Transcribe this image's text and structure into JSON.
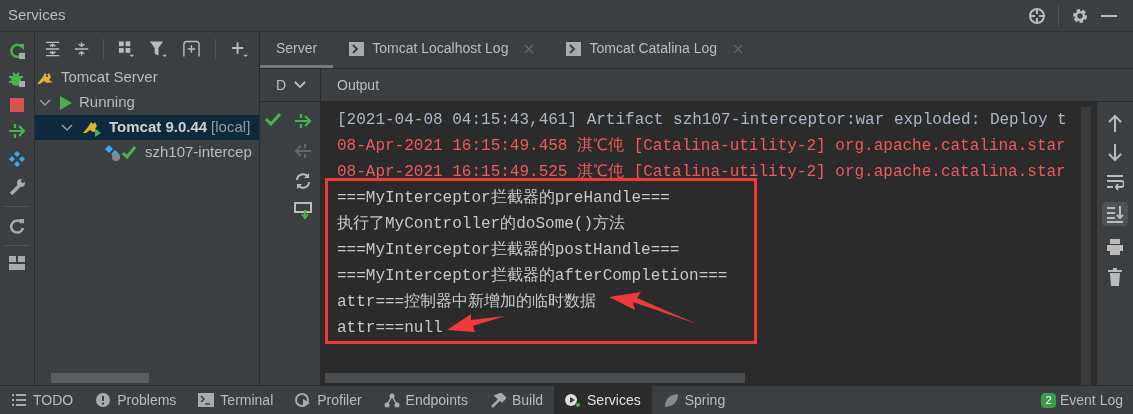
{
  "window": {
    "title": "Services"
  },
  "tree": [
    {
      "label": "Tomcat Server",
      "selected": false,
      "kind": "server",
      "children": [
        {
          "label": "Running",
          "selected": false,
          "expanded": true,
          "kind": "group",
          "children": [
            {
              "label": "Tomcat 9.0.44",
              "suffix": "[local]",
              "selected": true,
              "expanded": true,
              "kind": "instance",
              "children": [
                {
                  "label": "szh107-intercep",
                  "selected": false,
                  "kind": "artifact"
                }
              ]
            }
          ]
        }
      ]
    }
  ],
  "tabs": [
    {
      "label": "Server",
      "selected": true,
      "closable": false
    },
    {
      "label": "Tomcat Localhost Log",
      "selected": false,
      "closable": true
    },
    {
      "label": "Tomcat Catalina Log",
      "selected": false,
      "closable": true
    }
  ],
  "sub_header": {
    "dropdown": "D",
    "title": "Output"
  },
  "console": [
    {
      "text": "[2021-04-08 04:15:43,461] Artifact szh107-interceptor:war exploded: Deploy t",
      "kind": "info"
    },
    {
      "text": "08-Apr-2021 16:15:49.458 淇℃伅 [Catalina-utility-2] org.apache.catalina.star",
      "kind": "error"
    },
    {
      "text": "08-Apr-2021 16:15:49.525 淇℃伅 [Catalina-utility-2] org.apache.catalina.star",
      "kind": "error"
    },
    {
      "text": "===MyInterceptor拦截器的preHandle===",
      "kind": "out"
    },
    {
      "text": "执行了MyController的doSome()方法",
      "kind": "out"
    },
    {
      "text": "===MyInterceptor拦截器的postHandle===",
      "kind": "out"
    },
    {
      "text": "===MyInterceptor拦截器的afterCompletion===",
      "kind": "out"
    },
    {
      "text": "attr===控制器中新增加的临时数据",
      "kind": "out"
    },
    {
      "text": "attr===null",
      "kind": "out"
    }
  ],
  "tool_windows": [
    {
      "label": "TODO",
      "selected": false
    },
    {
      "label": "Problems",
      "selected": false
    },
    {
      "label": "Terminal",
      "selected": false
    },
    {
      "label": "Profiler",
      "selected": false
    },
    {
      "label": "Endpoints",
      "selected": false
    },
    {
      "label": "Build",
      "selected": false
    },
    {
      "label": "Services",
      "selected": true
    },
    {
      "label": "Spring",
      "selected": false
    }
  ],
  "event_log": {
    "label": "Event Log",
    "badge": "2"
  }
}
